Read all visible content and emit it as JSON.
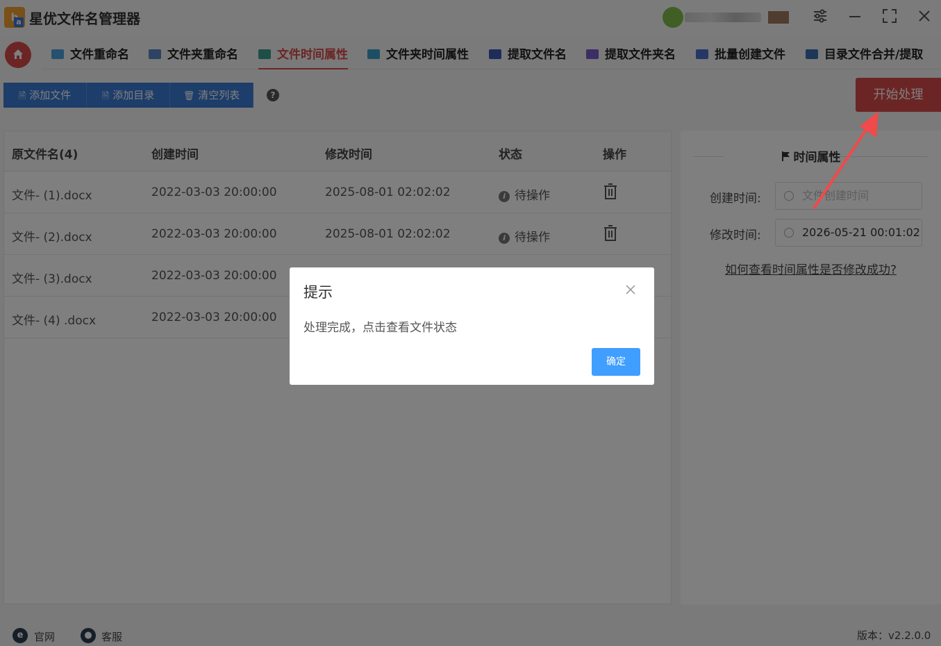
{
  "app": {
    "title": "星优文件名管理器",
    "logo_text": "b",
    "logo_sub": "a"
  },
  "window_controls": {
    "settings": "⚙",
    "minimize": "—",
    "maximize": "⛶",
    "close": "✕"
  },
  "nav": {
    "tabs": [
      {
        "label": "文件重命名",
        "icon": "file-rename-icon",
        "color": "#4aa3df"
      },
      {
        "label": "文件夹重命名",
        "icon": "folder-rename-icon",
        "color": "#5b87c7"
      },
      {
        "label": "文件时间属性",
        "icon": "file-time-icon",
        "color": "#3a9f8f",
        "active": true
      },
      {
        "label": "文件夹时间属性",
        "icon": "folder-time-icon",
        "color": "#3a9fc8"
      },
      {
        "label": "提取文件名",
        "icon": "extract-filename-icon",
        "color": "#3a5bb0"
      },
      {
        "label": "提取文件夹名",
        "icon": "extract-foldername-icon",
        "color": "#7a5bc8"
      },
      {
        "label": "批量创建文件",
        "icon": "batch-create-icon",
        "color": "#4a6fc8"
      },
      {
        "label": "目录文件合并/提取",
        "icon": "dir-merge-icon",
        "color": "#3a6fb0"
      }
    ]
  },
  "toolbar": {
    "add_file": "添加文件",
    "add_dir": "添加目录",
    "clear_list": "清空列表",
    "help": "?",
    "start": "开始处理"
  },
  "table": {
    "headers": [
      "原文件名(4)",
      "创建时间",
      "修改时间",
      "状态",
      "操作"
    ],
    "rows": [
      {
        "name": "文件- (1).docx",
        "created": "2022-03-03 20:00:00",
        "modified": "2025-08-01 02:02:02",
        "status": "待操作"
      },
      {
        "name": "文件- (2).docx",
        "created": "2022-03-03 20:00:00",
        "modified": "2025-08-01 02:02:02",
        "status": "待操作"
      },
      {
        "name": "文件- (3).docx",
        "created": "2022-03-03 20:00:00",
        "modified": "",
        "status": ""
      },
      {
        "name": "文件- (4) .docx",
        "created": "2022-03-03 20:00:00",
        "modified": "",
        "status": ""
      }
    ]
  },
  "side": {
    "title": "时间属性",
    "create_label": "创建时间:",
    "create_placeholder": "文件创建时间",
    "modify_label": "修改时间:",
    "modify_value": "2026-05-21 00:01:02",
    "help_link": "如何查看时间属性是否修改成功?"
  },
  "footer": {
    "website": "官网",
    "support": "客服",
    "version": "版本：v2.2.0.0"
  },
  "dialog": {
    "title": "提示",
    "message": "处理完成，点击查看文件状态",
    "ok": "确定",
    "close": "✕"
  },
  "colors": {
    "accent": "#d94a4a",
    "primary": "#3a7bd5",
    "dialog_button": "#409eff"
  }
}
